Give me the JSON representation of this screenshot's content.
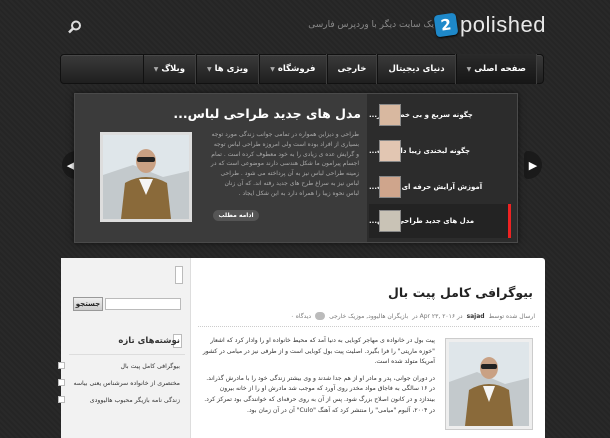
{
  "header": {
    "logo_badge": "2",
    "logo_text": "polished",
    "tagline": "یک سایت دیگر با وردپرس فارسی"
  },
  "nav": {
    "items": [
      {
        "label": "صفحه اصلی",
        "active": true
      },
      {
        "label": "دنیای دیجیتال",
        "active": false
      },
      {
        "label": "خارجی",
        "active": false
      },
      {
        "label": "فروشگاه",
        "active": false
      },
      {
        "label": "ویژی ها",
        "active": false
      },
      {
        "label": "وبلاگ",
        "active": false
      }
    ]
  },
  "slider": {
    "title": "مدل های جدید طراحی لباس...",
    "body": "طراحی و دیزاین همواره در تمامی جوانب زندگی مورد توجه بسیاری از افراد بوده است ولی امروزه طراحی لباس توجه و گرایش عده ی زیادی را به خود معطوف کرده است . تمام اجسام پیرامون ما شکل هندسی دارند موضوعی است که در زمینه طراحی لباس نیز به آن پرداخته می شود . طراحی لباس نیز به سراغ طرح های جدید رفته اند. که آن زنان لباس نحوه زیبا را همراه دارد به این شکل ایجاد .",
    "more_label": "ادامه مطلب",
    "items": [
      {
        "label": "چگونه سریع و بی خطر لاغر...",
        "active": false
      },
      {
        "label": "چگونه لبخندی زیبا داشته ب...",
        "active": false
      },
      {
        "label": "آموزش آرایش حرفه ای صورت...",
        "active": false
      },
      {
        "label": "مدل های جدید طراحی لباس...",
        "active": true
      }
    ]
  },
  "sidebar": {
    "search_button": "جستجو",
    "recent_heading": "نوشته‌های تازه",
    "recent_posts": [
      "بیوگرافی کامل پیت بال",
      "مختصری از خانواده سرشناس یعنی بیاسه",
      "زندگی نامه بازیگر محبوب هالیوودی"
    ]
  },
  "post": {
    "title": "بیوگرافی کامل پیت بال",
    "meta_prefix": "ارسال شده توسط",
    "author": "sajad",
    "meta_date": "در Apr ۲۳, ۲۰۱۶ در",
    "meta_category": "بازیگران هالیوود, موزیک خارجی",
    "meta_comments": "دیدگاه ۰",
    "paragraphs": [
      "پیت بول در خانواده ی مهاجر کوبایی به دنیا آمد که محیط خانواده او را وادار کرد که اشعار \"خوزه ماریتی\" را فرا بگیرد. اصلیت پیت بول کوبایی است و از طرفی نیز در میامی در کشور آمریکا متولد شده است.",
      "در دوران جوانی، پدر و مادر او از هم جدا شدند و وی بیشتر زندگی خود را با مادرش گذراند. در ۱۶ سالگی به فاجاق مواد مخدر روی آورد که موجب شد مادرش او را از خانه بیرون بیندازد و در کانون اصلاح بزرگ شود. پس از آن به روی حرفه‌ای که خوانندگی بود تمرکز کرد. در ۲۰۰۴، آلبوم \"میامی\" را منتشر کرد که آهنگ \"Culo\" آن در آن زمان بود."
    ]
  },
  "colors": {
    "background": "#262626",
    "active_marker": "#e22222",
    "logo_badge": "#1e88c9"
  }
}
